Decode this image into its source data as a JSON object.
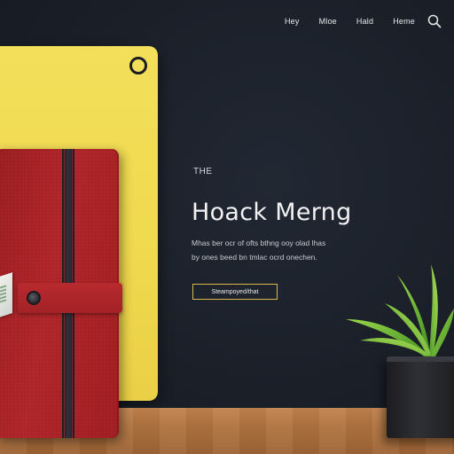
{
  "nav": {
    "items": [
      "Hey",
      "Mloe",
      "Hald",
      "Heme"
    ],
    "search_icon": "search-icon"
  },
  "hero": {
    "eyebrow": "THE",
    "title": "Hoack Merng",
    "body_line1": "Mhas ber ocr of ofts bthng ooy olad lhas",
    "body_line2": "by ones beed bn tmlac ocrd onechen.",
    "cta": "Steampoyed/that"
  },
  "colors": {
    "background": "#1b2029",
    "yellow_card": "#f0d94e",
    "notebook": "#b2272b",
    "cta_border": "#d9b84a",
    "table": "#b0733f"
  }
}
